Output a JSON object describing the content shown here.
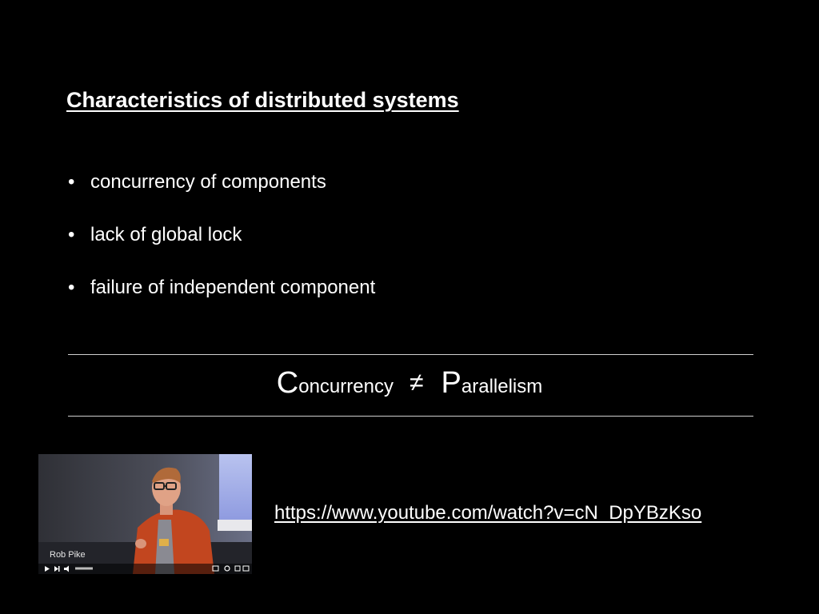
{
  "slide": {
    "title": "Characteristics of distributed systems",
    "bullets": [
      "concurrency of components",
      "lack of global lock",
      "failure of independent component"
    ],
    "equation": {
      "left_initial": "C",
      "left_rest": "oncurrency",
      "operator": "≠",
      "right_initial": "P",
      "right_rest": "arallelism"
    },
    "video": {
      "speaker_name": "Rob Pike"
    },
    "link_text": "https://www.youtube.com/watch?v=cN_DpYBzKso"
  },
  "colors": {
    "background": "#000000",
    "text": "#ffffff",
    "rule": "#d0d0d0",
    "jacket": "#c2461f"
  }
}
